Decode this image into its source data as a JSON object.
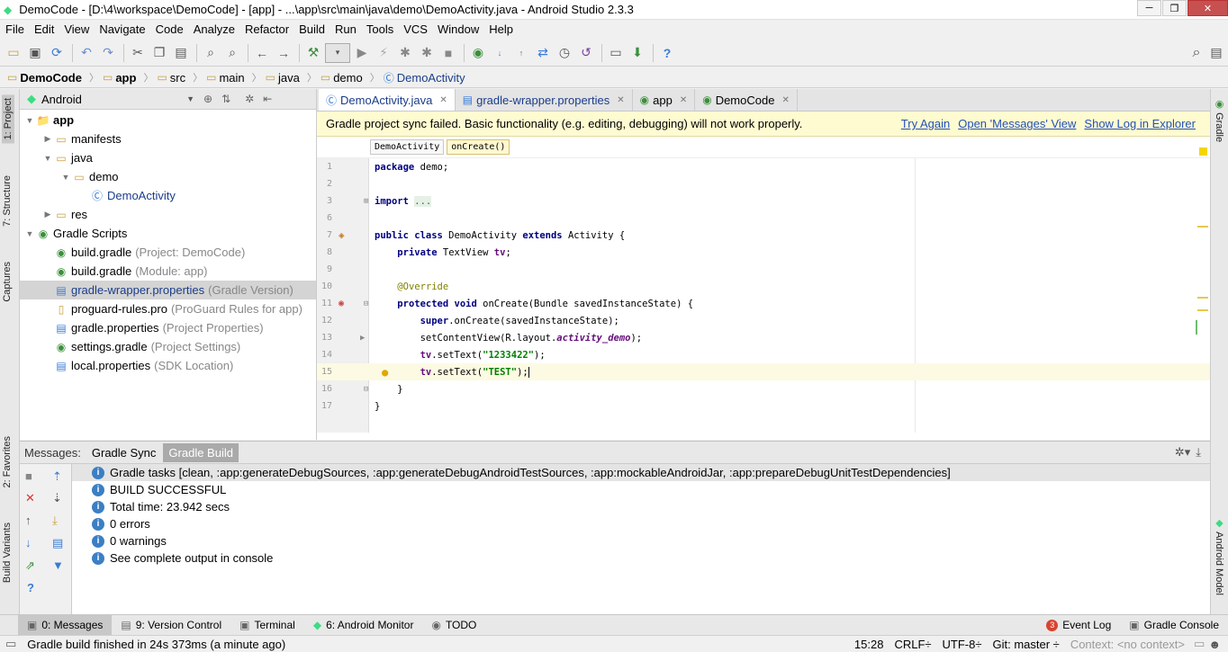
{
  "window": {
    "title": "DemoCode - [D:\\4\\workspace\\DemoCode] - [app] - ...\\app\\src\\main\\java\\demo\\DemoActivity.java - Android Studio 2.3.3"
  },
  "menu": [
    "File",
    "Edit",
    "View",
    "Navigate",
    "Code",
    "Analyze",
    "Refactor",
    "Build",
    "Run",
    "Tools",
    "VCS",
    "Window",
    "Help"
  ],
  "breadcrumb": [
    "DemoCode",
    "app",
    "src",
    "main",
    "java",
    "demo",
    "DemoActivity"
  ],
  "project": {
    "view_selector": "Android",
    "tree": [
      {
        "label": "app",
        "indent": 0,
        "arrow": "▼",
        "icon": "folder-icon",
        "glyph": "📁",
        "bold": true
      },
      {
        "label": "manifests",
        "indent": 1,
        "arrow": "▶",
        "icon": "folder-icon",
        "glyph": "▭"
      },
      {
        "label": "java",
        "indent": 1,
        "arrow": "▼",
        "icon": "folder-icon",
        "glyph": "▭"
      },
      {
        "label": "demo",
        "indent": 2,
        "arrow": "▼",
        "icon": "package-icon",
        "glyph": "▭"
      },
      {
        "label": "DemoActivity",
        "indent": 3,
        "arrow": "",
        "icon": "class-icon",
        "glyph": "Ⓒ",
        "blue": true
      },
      {
        "label": "res",
        "indent": 1,
        "arrow": "▶",
        "icon": "res-folder-icon",
        "glyph": "▭"
      },
      {
        "label": "Gradle Scripts",
        "indent": 0,
        "arrow": "▼",
        "icon": "gradle-icon",
        "glyph": "◉"
      },
      {
        "label": "build.gradle",
        "hint": "(Project: DemoCode)",
        "indent": 1,
        "arrow": "",
        "icon": "gradle-file-icon",
        "glyph": "◉"
      },
      {
        "label": "build.gradle",
        "hint": "(Module: app)",
        "indent": 1,
        "arrow": "",
        "icon": "gradle-file-icon",
        "glyph": "◉"
      },
      {
        "label": "gradle-wrapper.properties",
        "hint": "(Gradle Version)",
        "indent": 1,
        "arrow": "",
        "icon": "properties-icon",
        "glyph": "▤",
        "selected": true,
        "blue": true
      },
      {
        "label": "proguard-rules.pro",
        "hint": "(ProGuard Rules for app)",
        "indent": 1,
        "arrow": "",
        "icon": "file-icon",
        "glyph": "▯"
      },
      {
        "label": "gradle.properties",
        "hint": "(Project Properties)",
        "indent": 1,
        "arrow": "",
        "icon": "properties-icon",
        "glyph": "▤"
      },
      {
        "label": "settings.gradle",
        "hint": "(Project Settings)",
        "indent": 1,
        "arrow": "",
        "icon": "gradle-file-icon",
        "glyph": "◉"
      },
      {
        "label": "local.properties",
        "hint": "(SDK Location)",
        "indent": 1,
        "arrow": "",
        "icon": "properties-icon",
        "glyph": "▤"
      }
    ]
  },
  "left_tabs": [
    "1: Project",
    "7: Structure",
    "Captures",
    "2: Favorites",
    "Build Variants"
  ],
  "right_tabs": [
    "Gradle",
    "Android Model"
  ],
  "editor": {
    "tabs": [
      {
        "label": "DemoActivity.java",
        "active": true,
        "glyph": "Ⓒ"
      },
      {
        "label": "gradle-wrapper.properties",
        "active": false,
        "glyph": "▤"
      },
      {
        "label": "app",
        "active": false,
        "glyph": "◉"
      },
      {
        "label": "DemoCode",
        "active": false,
        "glyph": "◉"
      }
    ],
    "notification": "Gradle project sync failed. Basic functionality (e.g. editing, debugging) will not work properly.",
    "notification_links": [
      "Try Again",
      "Open 'Messages' View",
      "Show Log in Explorer"
    ],
    "code_breadcrumb": [
      "DemoActivity",
      "onCreate()"
    ],
    "line_numbers": [
      "1",
      "2",
      "3",
      "6",
      "7",
      "8",
      "9",
      "10",
      "11",
      "12",
      "13",
      "14",
      "15",
      "16",
      "17"
    ]
  },
  "messages": {
    "header_label": "Messages:",
    "tabs": [
      "Gradle Sync",
      "Gradle Build"
    ],
    "rows": [
      "Gradle tasks [clean, :app:generateDebugSources, :app:generateDebugAndroidTestSources, :app:mockableAndroidJar, :app:prepareDebugUnitTestDependencies]",
      "BUILD SUCCESSFUL",
      "Total time: 23.942 secs",
      "0 errors",
      "0 warnings",
      "See complete output in console"
    ]
  },
  "bottom_tools": [
    {
      "label": "0: Messages",
      "on": true,
      "glyph": "▣"
    },
    {
      "label": "9: Version Control",
      "glyph": "▤"
    },
    {
      "label": "Terminal",
      "glyph": "▣"
    },
    {
      "label": "6: Android Monitor",
      "glyph": "◆"
    },
    {
      "label": "TODO",
      "glyph": "◉"
    }
  ],
  "bottom_right_tools": [
    {
      "label": "Event Log",
      "badge": "3"
    },
    {
      "label": "Gradle Console"
    }
  ],
  "status": {
    "message": "Gradle build finished in 24s 373ms (a minute ago)",
    "position": "15:28",
    "line_sep": "CRLF÷",
    "encoding": "UTF-8÷",
    "git": "Git: master ÷",
    "context": "Context: <no context>"
  }
}
